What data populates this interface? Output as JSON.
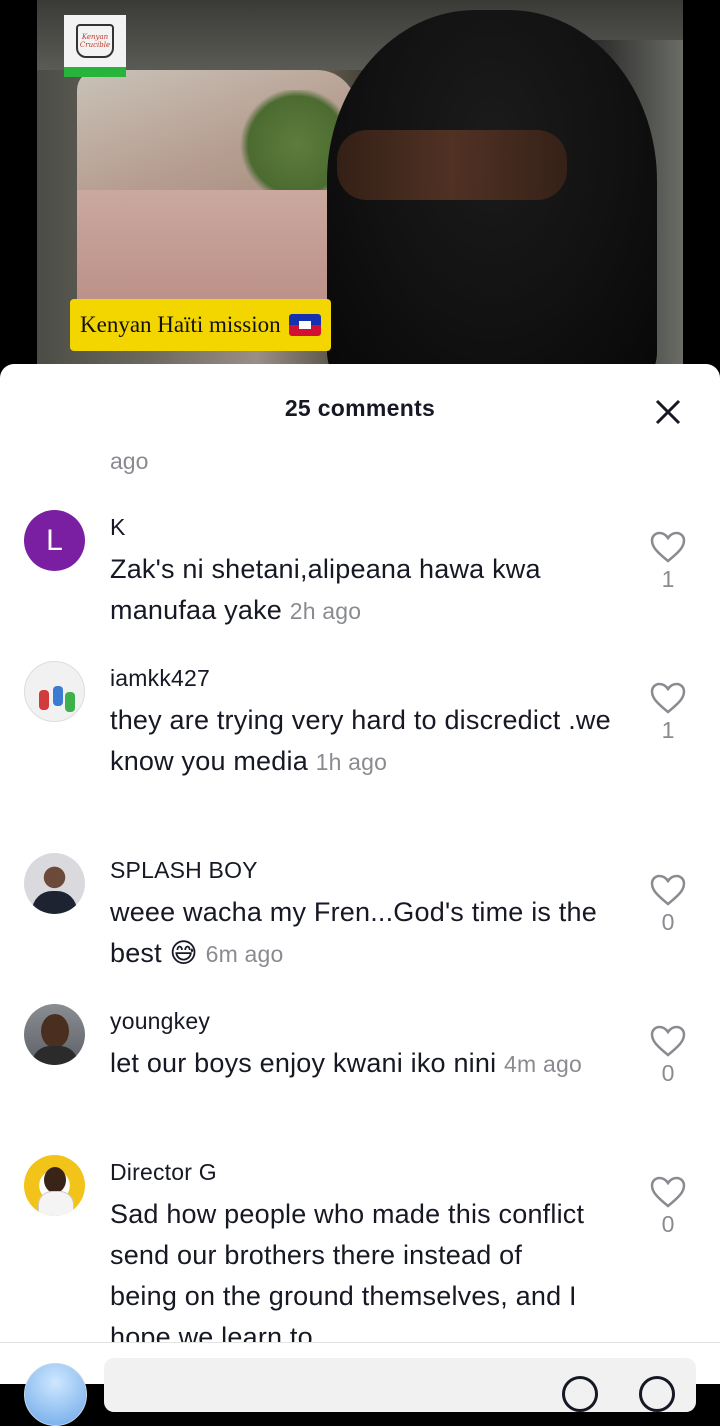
{
  "video": {
    "logo_text": "Kenyan Crucible",
    "caption": "Kenyan Haïti mission",
    "caption_flag": "haiti-flag"
  },
  "sheet": {
    "title": "25 comments",
    "close_icon": "close-icon",
    "orphan_timestamp": "ago"
  },
  "comments": [
    {
      "username": "K",
      "avatar_letter": "L",
      "avatar_color": "#7b1fa2",
      "text": "Zak's ni shetani,alipeana hawa kwa manufaa yake",
      "time": "2h ago",
      "likes": "1"
    },
    {
      "username": "iamkk427",
      "text": "they are trying very hard to discredict .we know you media",
      "time": "1h ago",
      "likes": "1"
    },
    {
      "username": "SPLASH BOY",
      "text": "weee wacha my Fren...God's time is the best 😅",
      "time": "6m ago",
      "likes": "0"
    },
    {
      "username": "youngkey",
      "text": "let our boys enjoy kwani iko nini",
      "time": "4m ago",
      "likes": "0"
    },
    {
      "username": "Director G",
      "text": "Sad how people who made this conflict send our brothers there instead of being on the ground themselves, and I hope we learn to",
      "likes": "0"
    }
  ],
  "colors": {
    "caption_bg": "#f3d500",
    "logo_strip": "#27b43a",
    "muted_text": "#8a8b91"
  }
}
